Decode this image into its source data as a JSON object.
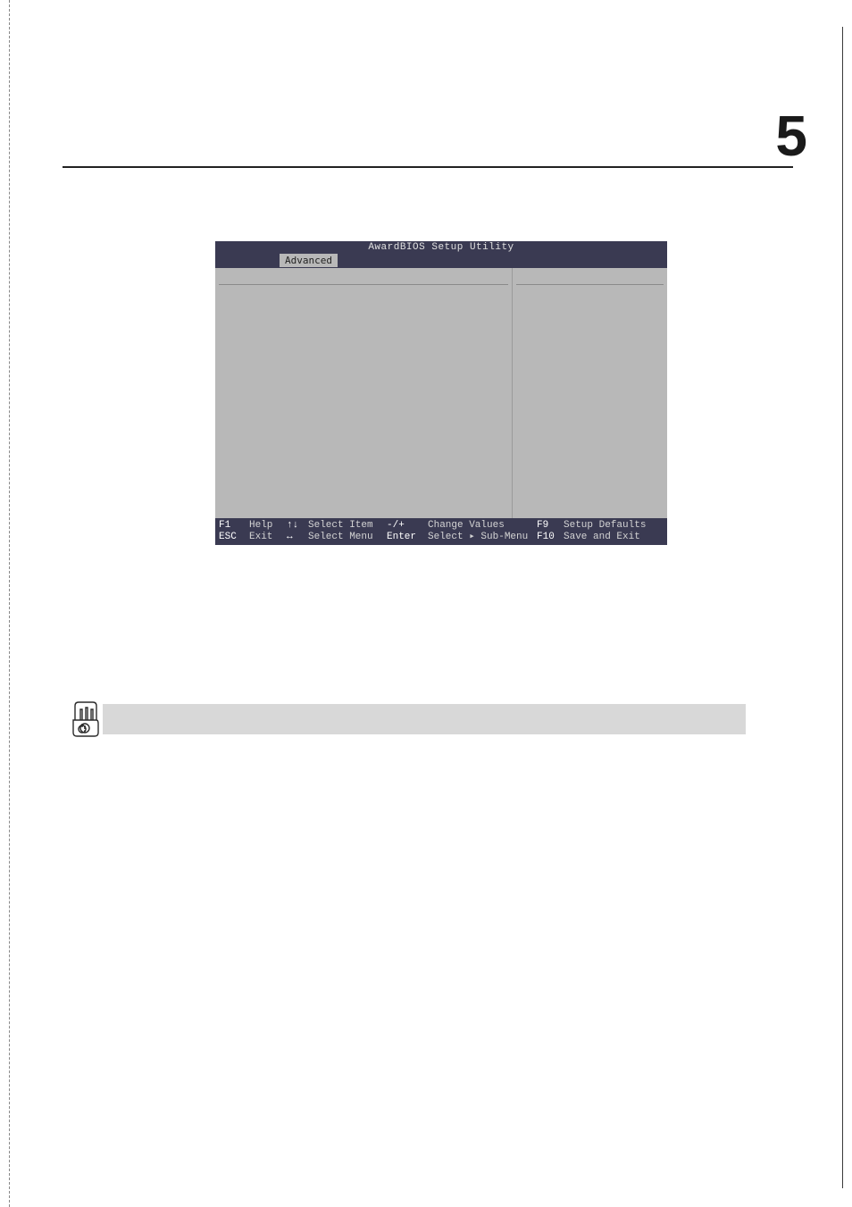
{
  "chapter_number": "5",
  "bios": {
    "title": "AwardBIOS Setup Utility",
    "tab": "Advanced",
    "footer": {
      "row1": {
        "k1": "F1",
        "v1": "Help",
        "k2": "↑↓",
        "v2": "Select Item",
        "k3": "-/+",
        "v3": "Change Values",
        "k4": "F9",
        "v4": "Setup Defaults"
      },
      "row2": {
        "k1": "ESC",
        "v1": "Exit",
        "k2": "↔",
        "v2": "Select Menu",
        "k3": "Enter",
        "v3": "Select ▸ Sub-Menu",
        "k4": "F10",
        "v4": "Save and Exit"
      }
    }
  }
}
